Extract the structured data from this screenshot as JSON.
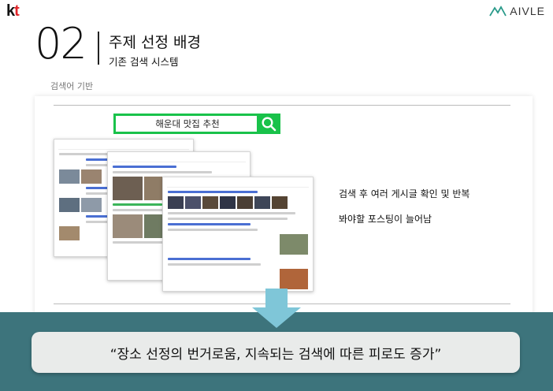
{
  "brand": {
    "left_logo_k": "k",
    "left_logo_t": "t",
    "right_logo": "AIVLE"
  },
  "header": {
    "number": "02",
    "title": "주제 선정 배경",
    "subtitle": "기존 검색 시스템"
  },
  "section": {
    "label": "검색어 기반"
  },
  "search": {
    "query": "해운대 맛집 추천"
  },
  "description": {
    "line1": "검색 후 여러 게시글 확인 및 반복",
    "line2": "봐야할 포스팅이 늘어남"
  },
  "conclusion": {
    "quote": "“장소 선정의 번거로움, 지속되는 검색에 따른 피로도 증가”"
  },
  "colors": {
    "search_green": "#19c24a",
    "band": "#3d747c",
    "arrow": "#7fc6d8",
    "kt_red": "#e2262a",
    "aivle_teal": "#2a9a8a"
  }
}
